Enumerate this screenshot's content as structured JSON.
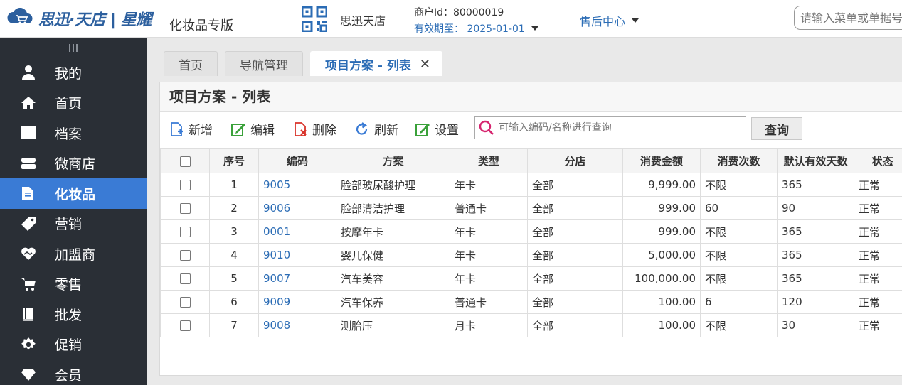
{
  "header": {
    "logo_text": "思迅·天店 | 星耀",
    "edition": "化妆品专版",
    "shop_name": "思迅天店",
    "merchant_id": "商户Id：80000019",
    "valid_until": "有效期至： 2025-01-01",
    "after_sales": "售后中心",
    "search_placeholder": "请输入菜单或单据号"
  },
  "sidebar": {
    "items": [
      {
        "label": "我的",
        "icon": "user-icon"
      },
      {
        "label": "首页",
        "icon": "home-icon"
      },
      {
        "label": "档案",
        "icon": "archive-icon"
      },
      {
        "label": "微商店",
        "icon": "store-icon"
      },
      {
        "label": "化妆品",
        "icon": "folder-icon",
        "active": true
      },
      {
        "label": "营销",
        "icon": "tag-icon"
      },
      {
        "label": "加盟商",
        "icon": "handshake-icon"
      },
      {
        "label": "零售",
        "icon": "cart-icon"
      },
      {
        "label": "批发",
        "icon": "book-icon"
      },
      {
        "label": "促销",
        "icon": "gear-badge-icon"
      },
      {
        "label": "会员",
        "icon": "diamond-icon"
      }
    ]
  },
  "tabs": [
    {
      "label": "首页"
    },
    {
      "label": "导航管理"
    },
    {
      "label": "项目方案 - 列表",
      "active": true,
      "close": "✕"
    }
  ],
  "panel": {
    "title": "项目方案 - 列表",
    "toolbar": {
      "add": "新增",
      "edit": "编辑",
      "delete": "删除",
      "refresh": "刷新",
      "settings": "设置",
      "query_placeholder": "可输入编码/名称进行查询",
      "query_button": "查询"
    }
  },
  "table": {
    "columns": [
      "序号",
      "编码",
      "方案",
      "类型",
      "分店",
      "消费金额",
      "消费次数",
      "默认有效天数",
      "状态"
    ],
    "rows": [
      {
        "no": "1",
        "code": "9005",
        "plan": "脸部玻尿酸护理",
        "type": "年卡",
        "branch": "全部",
        "amount": "9,999.00",
        "times": "不限",
        "days": "365",
        "status": "正常"
      },
      {
        "no": "2",
        "code": "9006",
        "plan": "脸部清洁护理",
        "type": "普通卡",
        "branch": "全部",
        "amount": "999.00",
        "times": "60",
        "days": "90",
        "status": "正常"
      },
      {
        "no": "3",
        "code": "0001",
        "plan": "按摩年卡",
        "type": "年卡",
        "branch": "全部",
        "amount": "999.00",
        "times": "不限",
        "days": "365",
        "status": "正常"
      },
      {
        "no": "4",
        "code": "9010",
        "plan": "婴儿保健",
        "type": "年卡",
        "branch": "全部",
        "amount": "5,000.00",
        "times": "不限",
        "days": "365",
        "status": "正常"
      },
      {
        "no": "5",
        "code": "9007",
        "plan": "汽车美容",
        "type": "年卡",
        "branch": "全部",
        "amount": "100,000.00",
        "times": "不限",
        "days": "365",
        "status": "正常"
      },
      {
        "no": "6",
        "code": "9009",
        "plan": "汽车保养",
        "type": "普通卡",
        "branch": "全部",
        "amount": "100.00",
        "times": "6",
        "days": "120",
        "status": "正常"
      },
      {
        "no": "7",
        "code": "9008",
        "plan": "测胎压",
        "type": "月卡",
        "branch": "全部",
        "amount": "100.00",
        "times": "不限",
        "days": "30",
        "status": "正常"
      }
    ]
  },
  "colors": {
    "sidebar_bg": "#2a2f36",
    "sidebar_active": "#3a7bd5",
    "link_blue": "#2b6cb5",
    "add_icon": "#3a7bd5",
    "edit_icon": "#3aa13a",
    "delete_icon": "#d9342b",
    "search_icon": "#d6246e"
  }
}
